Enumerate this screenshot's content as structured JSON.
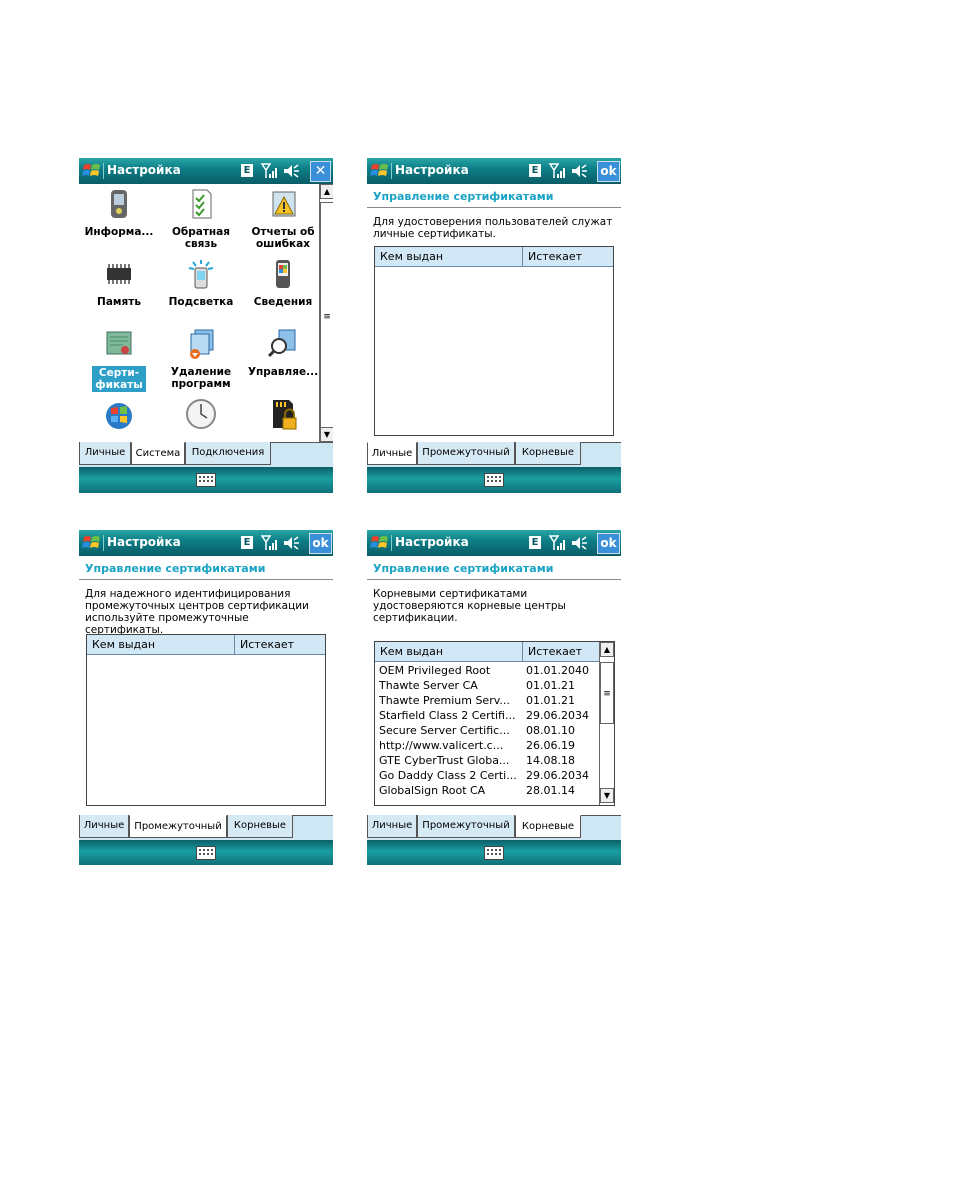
{
  "app_title": "Настройка",
  "status_icons": {
    "network": "E",
    "signal": "signal-icon",
    "volume": "volume-icon"
  },
  "close_label": "✕",
  "ok_label": "ok",
  "tabs_main": [
    "Личные",
    "Система",
    "Подключения"
  ],
  "tabs_cert": [
    "Личные",
    "Промежуточный",
    "Корневые"
  ],
  "system_items": [
    {
      "label": "Информа...",
      "icon": "device-info-icon"
    },
    {
      "label": "Обратная связь",
      "icon": "feedback-icon"
    },
    {
      "label": "Отчеты об ошибках",
      "icon": "error-reports-icon"
    },
    {
      "label": "Память",
      "icon": "memory-icon"
    },
    {
      "label": "Подсветка",
      "icon": "backlight-icon"
    },
    {
      "label": "Сведения",
      "icon": "about-icon"
    },
    {
      "label": "Серти-фикаты",
      "icon": "certificates-icon"
    },
    {
      "label": "Удаление программ",
      "icon": "remove-programs-icon"
    },
    {
      "label": "Управляе...",
      "icon": "managed-programs-icon"
    }
  ],
  "cert_heading": "Управление сертификатами",
  "personal_desc": "Для удостоверения пользователей служат личные сертификаты.",
  "intermediate_desc": "Для надежного идентифицирования промежуточных центров сертификации используйте промежуточные сертификаты.",
  "root_desc": "Корневыми сертификатами удостоверяются корневые центры сертификации.",
  "col_issuer": "Кем выдан",
  "col_expires": "Истекает",
  "root_certs": [
    {
      "issuer": "OEM Privileged Root",
      "expires": "01.01.2040"
    },
    {
      "issuer": "Thawte Server CA",
      "expires": "01.01.21"
    },
    {
      "issuer": "Thawte Premium Serv...",
      "expires": "01.01.21"
    },
    {
      "issuer": "Starfield Class 2 Certifi...",
      "expires": "29.06.2034"
    },
    {
      "issuer": "Secure Server Certific...",
      "expires": "08.01.10"
    },
    {
      "issuer": "http://www.valicert.c...",
      "expires": "26.06.19"
    },
    {
      "issuer": "GTE CyberTrust Globa...",
      "expires": "14.08.18"
    },
    {
      "issuer": "Go Daddy Class 2 Certi...",
      "expires": "29.06.2034"
    },
    {
      "issuer": "GlobalSign Root CA",
      "expires": "28.01.14"
    }
  ]
}
